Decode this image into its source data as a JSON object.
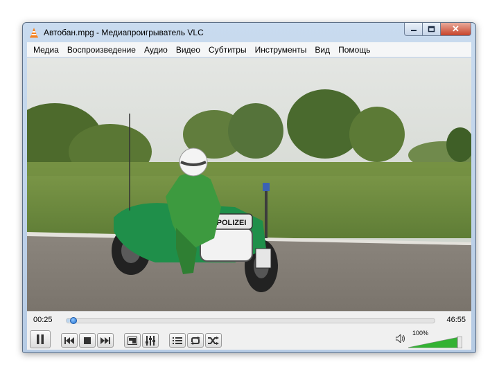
{
  "window": {
    "title": "Автобан.mpg - Медиапроигрыватель VLC",
    "controls": {
      "minimize": "minimize",
      "maximize": "maximize",
      "close": "✕"
    }
  },
  "menu": {
    "items": [
      "Медиа",
      "Воспроизведение",
      "Аудио",
      "Видео",
      "Субтитры",
      "Инструменты",
      "Вид",
      "Помощь"
    ]
  },
  "video": {
    "plate_text": "POLIZEI"
  },
  "player": {
    "current_time": "00:25",
    "total_time": "46:55",
    "progress": 0.009,
    "volume_label": "100%",
    "volume": 1.0
  },
  "icons": {
    "app": "vlc-cone-icon",
    "pause": "pause-icon",
    "prev": "previous-icon",
    "stop": "stop-icon",
    "next": "next-icon",
    "fullscreen": "fullscreen-icon",
    "extended": "equalizer-icon",
    "playlist": "playlist-icon",
    "loop": "loop-icon",
    "shuffle": "shuffle-icon",
    "mute": "speaker-icon"
  },
  "colors": {
    "accent": "#1e6fd0",
    "volume_fill": "#33b233"
  }
}
